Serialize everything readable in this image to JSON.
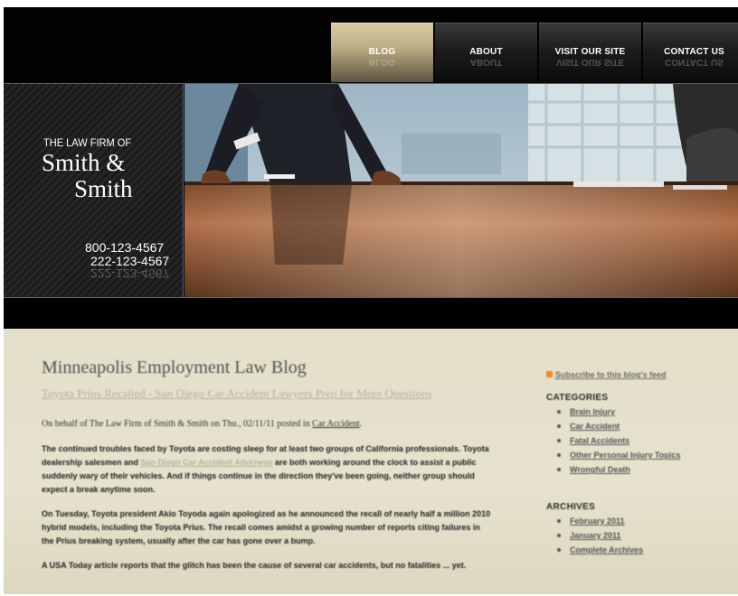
{
  "nav": {
    "items": [
      {
        "label": "BLOG",
        "active": true
      },
      {
        "label": "ABOUT",
        "active": false
      },
      {
        "label": "VISIT OUR SITE",
        "active": false
      },
      {
        "label": "CONTACT US",
        "active": false
      }
    ]
  },
  "brand": {
    "tagline": "THE LAW FIRM OF",
    "name_line1": "Smith &",
    "name_line2": "Smith",
    "phone1": "800-123-4567",
    "phone2": "222-123-4567"
  },
  "blog": {
    "title": "Minneapolis Employment Law Blog",
    "post_title": "Toyota Prius Recalled - San Diego Car Accident Lawyers Prep for More Questions",
    "byline_prefix": "On behalf of The Law Firm of Smith & Smith on Thu., 02/11/11 posted in",
    "byline_category": "Car Accident",
    "byline_suffix": ".",
    "para1_a": "The continued troubles faced by Toyota are costing sleep for at least two groups of California professionals. Toyota dealership salesmen and",
    "para1_link": "San Diego Car Accident Attorneys",
    "para1_b": "are both working around the clock to assist a public suddenly wary of their vehicles. And if things continue in the direction they've been going, neither group should expect a break anytime soon.",
    "para2": "On Tuesday, Toyota president Akio Toyoda again apologized as he announced the recall of nearly half a million 2010 hybrid models, including the Toyota Prius. The recall comes amidst a growing number of reports citing failures in the Prius breaking system, usually after the car has gone over a bump.",
    "para3": "A USA Today article reports that the glitch has been the cause of several car accidents, but no fatalities ... yet."
  },
  "sidebar": {
    "feed_label": "Subscribe to this blog's feed",
    "categories_heading": "CATEGORIES",
    "categories": [
      "Brain Injury",
      "Car Accident",
      "Fatal Accidents",
      "Other Personal Injury Topics",
      "Wrongful Death"
    ],
    "archives_heading": "ARCHIVES",
    "archives": [
      "February 2011",
      "January 2011",
      "Complete Archives"
    ]
  },
  "colors": {
    "nav_active": "#bfae85",
    "hero_border": "#4a5fb0",
    "content_bg": "#e4dfc9",
    "rss_orange": "#f08a1c"
  }
}
